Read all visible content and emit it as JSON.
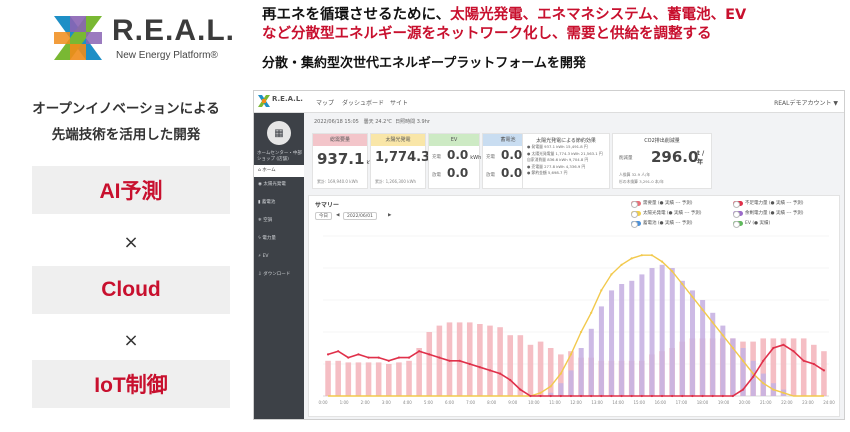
{
  "brand": {
    "name": "R.E.A.L.",
    "tagline": "New Energy Platform®",
    "colors": {
      "green": "#79b833",
      "blue": "#1e8fc6",
      "purple": "#8a64b4",
      "orange": "#f08c1a"
    }
  },
  "headline": {
    "line1_black": "再エネを循環させるために、",
    "line1_red": "太陽光発電、エネマネシステム、蓄電池、EV",
    "line2_red": "など分散型エネルギー源をネットワーク化し、需要と供給を調整する",
    "subhead": "分散・集約型次世代エネルギープラットフォームを開発"
  },
  "left_column": {
    "intro_line1": "オープンイノベーションによる",
    "intro_line2": "先端技術を活用した開発",
    "features": [
      "AI予測",
      "Cloud",
      "IoT制御"
    ],
    "separator": "×",
    "accent_color": "#c8102e"
  },
  "dashboard": {
    "app_name": "R.E.A.L.",
    "nav": [
      "マップ",
      "ダッシュボード",
      "サイト"
    ],
    "account": "REALデモアカウント ▼",
    "sidebar": {
      "user_line1": "ホームセンター・中部",
      "user_line2": "ショップ (店舗)",
      "items": [
        "ホーム",
        "太陽光発電",
        "蓄電池",
        "空調",
        "電力量",
        "EV",
        "ダウンロード"
      ],
      "active_index": 0
    },
    "datebar": {
      "date": "2022/06/18",
      "time": "15:05",
      "weather": "曇天",
      "temp": "24.2℃",
      "humidity_label": "日照時間",
      "humidity": "3.9hr"
    },
    "stats": [
      {
        "label": "総需要量",
        "value": "937.1",
        "unit": "kWh",
        "foot": "累計: 169,940.0 kWh",
        "color": "#f3c5ca"
      },
      {
        "label": "太陽光発電",
        "value": "1,774.3",
        "unit": "kWh",
        "foot": "累計: 1,266,300 kWh",
        "color": "#f9e6a8"
      },
      {
        "label": "EV",
        "value": "0.0",
        "unit": "kWh",
        "side_top": "充電",
        "side_bottom": "放電",
        "value2": "0.0",
        "color": "#cdeac4"
      },
      {
        "label": "蓄電池",
        "value": "0.0",
        "unit": "kWh",
        "side_top": "充電",
        "side_bottom": "放電",
        "value2": "0.0",
        "color": "#c9ddf1"
      }
    ],
    "savings_panel": {
      "title": "太陽光発電による節約効果",
      "rows": [
        "● 発電量   937.1 kWh   15,491.8 円",
        "● 太陽光発電量 1,774.3 kWh  21,563.1 円",
        "   自家消費量  836.6 kWh  9,704.8 円",
        "● 売電量   277.8 kWh  4,336.9 円",
        "● 節約金額           5,698.7 円"
      ]
    },
    "co2_panel": {
      "title": "CO2排出削減量",
      "label": "削減量",
      "value": "296.0",
      "unit": "t / 年",
      "sub1": "人換算   32.9 人/年",
      "sub2": "杉の木換算  3,291.0 本/年"
    },
    "summary": {
      "title": "サマリー",
      "controls": [
        "今日",
        "◀",
        "2022/06/01",
        "▶"
      ],
      "legend": [
        {
          "label": "需要量 (● 実績 --- 予測)",
          "color": "#e8707a"
        },
        {
          "label": "太陽光発電 (● 実績 --- 予測)",
          "color": "#f2cf4a"
        },
        {
          "label": "蓄電池 (● 実績 --- 予測)",
          "color": "#4a90d9"
        },
        {
          "label": "不足電力量 (● 実績 --- 予測)",
          "color": "#e0304a"
        },
        {
          "label": "余剰電力量 (● 実績 --- 予測)",
          "color": "#9b6bc9"
        },
        {
          "label": "EV (● 実績)",
          "color": "#5fb85c"
        }
      ]
    }
  },
  "chart_data": {
    "type": "bar",
    "title": "サマリー",
    "categories": [
      "0:00",
      "1:00",
      "2:00",
      "3:00",
      "4:00",
      "5:00",
      "6:00",
      "7:00",
      "8:00",
      "9:00",
      "10:00",
      "11:00",
      "12:00",
      "13:00",
      "14:00",
      "15:00",
      "16:00",
      "17:00",
      "18:00",
      "19:00",
      "20:00",
      "21:00",
      "22:00",
      "23:00",
      "24:00"
    ],
    "x_tick_labels": [
      "0:00",
      "1:00",
      "2:00",
      "3:00",
      "4:00",
      "5:00",
      "6:00",
      "7:00",
      "8:00",
      "9:00",
      "10:00",
      "11:00",
      "12:00",
      "13:00",
      "14:00",
      "15:00",
      "16:00",
      "17:00",
      "18:00",
      "19:00",
      "20:00",
      "21:00",
      "22:00",
      "23:00",
      "24:00"
    ],
    "ylim": [
      0,
      100
    ],
    "grid": true,
    "series": [
      {
        "name": "需要量",
        "kind": "bar",
        "color": "#f3b3ba",
        "values": [
          22,
          22,
          21,
          21,
          21,
          21,
          20,
          21,
          22,
          30,
          40,
          44,
          46,
          46,
          46,
          45,
          44,
          43,
          38,
          38,
          32,
          34,
          30,
          26,
          28,
          24,
          24,
          22,
          22,
          22,
          22,
          22,
          26,
          28,
          30,
          34,
          36,
          36,
          36,
          36,
          36,
          34,
          34,
          36,
          36,
          36,
          36,
          36,
          32,
          28
        ]
      },
      {
        "name": "余剰電力量",
        "kind": "bar",
        "color": "#c8b2e2",
        "values": [
          0,
          0,
          0,
          0,
          0,
          0,
          0,
          0,
          0,
          0,
          0,
          0,
          0,
          0,
          0,
          0,
          0,
          0,
          0,
          0,
          0,
          0,
          2,
          8,
          16,
          30,
          42,
          56,
          66,
          70,
          72,
          76,
          80,
          82,
          80,
          72,
          66,
          60,
          52,
          44,
          36,
          30,
          22,
          14,
          8,
          4,
          0,
          0,
          0,
          0
        ]
      },
      {
        "name": "太陽光発電",
        "kind": "line",
        "color": "#f2c94c",
        "values": [
          0,
          0,
          0,
          0,
          0,
          0,
          0,
          0,
          0,
          0,
          0,
          0,
          0,
          0,
          0,
          0,
          0,
          0,
          0,
          0,
          0,
          2,
          6,
          14,
          26,
          40,
          52,
          66,
          76,
          82,
          86,
          88,
          88,
          84,
          78,
          70,
          62,
          54,
          46,
          38,
          30,
          22,
          14,
          8,
          4,
          2,
          0,
          0,
          0,
          0
        ]
      },
      {
        "name": "不足電力量",
        "kind": "line",
        "color": "#e0304a",
        "values": [
          26,
          28,
          24,
          26,
          24,
          24,
          22,
          24,
          24,
          28,
          26,
          24,
          22,
          22,
          20,
          18,
          16,
          14,
          10,
          4,
          0,
          0,
          0,
          0,
          0,
          0,
          0,
          0,
          0,
          0,
          0,
          0,
          0,
          0,
          0,
          0,
          0,
          0,
          0,
          0,
          0,
          4,
          12,
          22,
          30,
          32,
          28,
          22,
          20,
          16
        ]
      }
    ]
  }
}
